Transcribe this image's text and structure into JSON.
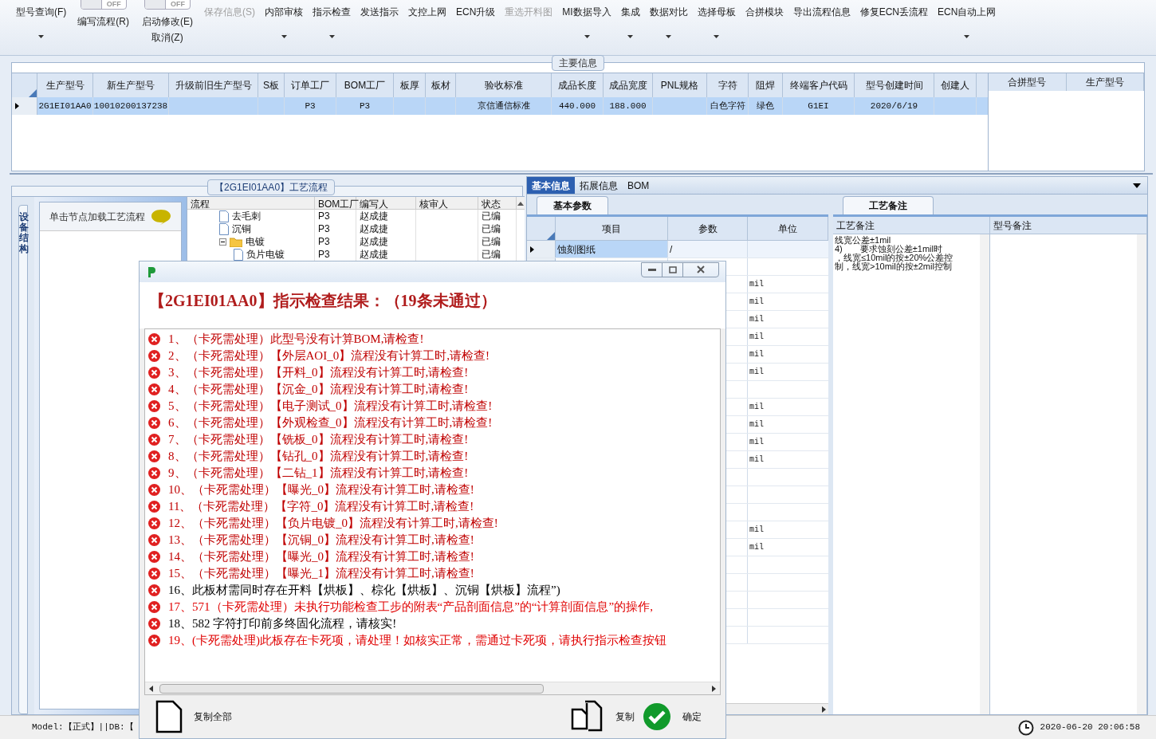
{
  "toolbar": [
    {
      "kind": "button",
      "label": "型号查询(F)",
      "dropdown": true,
      "disabled": false
    },
    {
      "kind": "toggle",
      "label": "编写流程(R)",
      "state": "OFF"
    },
    {
      "kind": "toggle",
      "label": "启动修改(E)",
      "label2": "取消(Z)",
      "state": "OFF"
    },
    {
      "kind": "button",
      "label": "保存信息(S)",
      "dropdown": false,
      "disabled": true
    },
    {
      "kind": "button",
      "label": "内部审核",
      "dropdown": true,
      "disabled": false
    },
    {
      "kind": "button",
      "label": "指示检查",
      "dropdown": true,
      "disabled": false
    },
    {
      "kind": "button",
      "label": "发送指示",
      "dropdown": false,
      "disabled": false
    },
    {
      "kind": "button",
      "label": "文控上网",
      "dropdown": false,
      "disabled": false
    },
    {
      "kind": "button",
      "label": "ECN升级",
      "dropdown": false,
      "disabled": false
    },
    {
      "kind": "button",
      "label": "重选开料图",
      "dropdown": false,
      "disabled": true
    },
    {
      "kind": "button",
      "label": "MI数据导入",
      "dropdown": true,
      "disabled": false
    },
    {
      "kind": "button",
      "label": "集成",
      "dropdown": true,
      "disabled": false
    },
    {
      "kind": "button",
      "label": "数据对比",
      "dropdown": true,
      "disabled": false
    },
    {
      "kind": "button",
      "label": "选择母板",
      "dropdown": true,
      "disabled": false
    },
    {
      "kind": "button",
      "label": "合拼模块",
      "dropdown": false,
      "disabled": false
    },
    {
      "kind": "button",
      "label": "导出流程信息",
      "dropdown": false,
      "disabled": false
    },
    {
      "kind": "button",
      "label": "修复ECN丢流程",
      "dropdown": false,
      "disabled": false
    },
    {
      "kind": "button",
      "label": "ECN自动上网",
      "dropdown": true,
      "disabled": false
    }
  ],
  "main_info": {
    "title": "主要信息",
    "columns": [
      "生产型号",
      "新生产型号",
      "升级前旧生产型号",
      "S板",
      "订单工厂",
      "BOM工厂",
      "板厚",
      "板材",
      "验收标准",
      "成品长度",
      "成品宽度",
      "PNL规格",
      "字符",
      "阻焊",
      "终端客户代码",
      "型号创建时间",
      "创建人"
    ],
    "rows": [
      {
        "selected": true,
        "cells": [
          "2G1EI01AA0",
          "10010200137238",
          "",
          "",
          "P3",
          "P3",
          "",
          "",
          "京信通信标准",
          "440.000",
          "188.000",
          "",
          "白色字符",
          "绿色",
          "G1EI",
          "2020/6/19",
          ""
        ]
      }
    ],
    "side_columns": [
      "合拼型号",
      "生产型号"
    ]
  },
  "process": {
    "title": "【2G1EI01AA0】工艺流程",
    "vertical_tab": "设备结构",
    "hint": "单击节点加载工艺流程",
    "columns": [
      "流程",
      "BOM工厂",
      "编写人",
      "核审人",
      "状态"
    ],
    "tree": [
      {
        "label": "去毛刺",
        "kind": "file",
        "cells": [
          "P3",
          "赵成捷",
          "",
          "已编"
        ]
      },
      {
        "label": "沉铜",
        "kind": "file",
        "cells": [
          "P3",
          "赵成捷",
          "",
          "已编"
        ]
      },
      {
        "label": "电镀",
        "kind": "folder",
        "expanded": true,
        "cells": [
          "P3",
          "赵成捷",
          "",
          "已编"
        ],
        "children": [
          {
            "label": "负片电镀",
            "kind": "file",
            "cells": [
              "P3",
              "赵成捷",
              "",
              "已编"
            ]
          }
        ]
      }
    ]
  },
  "detail": {
    "tabs": [
      {
        "label": "基本信息",
        "selected": true
      },
      {
        "label": "拓展信息",
        "selected": false
      },
      {
        "label": "BOM",
        "selected": false
      }
    ],
    "params": {
      "tab": "基本参数",
      "columns": [
        "项目",
        "参数",
        "单位"
      ],
      "rows": [
        {
          "item": "蚀刻图纸",
          "param": "/",
          "selected": true
        },
        {
          "selected": false
        },
        {
          "unit": "mil",
          "selected": false
        },
        {
          "unit": "mil",
          "selected": false
        },
        {
          "unit": "mil",
          "selected": false
        },
        {
          "unit": "mil",
          "selected": false
        },
        {
          "unit": "mil",
          "selected": false
        },
        {
          "unit": "mil",
          "selected": false
        },
        {
          "selected": false
        },
        {
          "unit": "mil",
          "selected": false
        },
        {
          "unit": "mil",
          "selected": false
        },
        {
          "unit": "mil",
          "selected": false
        },
        {
          "unit": "mil",
          "selected": false
        },
        {
          "selected": false
        },
        {
          "selected": false
        },
        {
          "selected": false
        },
        {
          "unit": "mil",
          "selected": false
        },
        {
          "unit": "mil",
          "selected": false
        },
        {
          "selected": false
        },
        {
          "selected": false
        },
        {
          "selected": false
        },
        {
          "selected": false
        },
        {
          "selected": false
        }
      ]
    },
    "remarks": {
      "tab": "工艺备注",
      "columns": [
        "工艺备注",
        "型号备注"
      ],
      "lines": [
        "线宽公差±1mil",
        "4)　　要求蚀刻公差±1mil时",
        "，线宽≤10mil的按±20%公差控",
        "制，线宽>10mil的按±2mil控制"
      ]
    }
  },
  "dialog": {
    "heading": "【2G1EI01AA0】指示检查结果：（19条未通过）",
    "items": [
      {
        "text": "1、（卡死需处理）此型号没有计算BOM,请检查!",
        "color": "#c00000"
      },
      {
        "text": "2、（卡死需处理）【外层AOI_0】流程没有计算工时,请检查!",
        "color": "#c00000"
      },
      {
        "text": "3、（卡死需处理）【开料_0】流程没有计算工时,请检查!",
        "color": "#c00000"
      },
      {
        "text": "4、（卡死需处理）【沉金_0】流程没有计算工时,请检查!",
        "color": "#c00000"
      },
      {
        "text": "5、（卡死需处理）【电子测试_0】流程没有计算工时,请检查!",
        "color": "#c00000"
      },
      {
        "text": "6、（卡死需处理）【外观检查_0】流程没有计算工时,请检查!",
        "color": "#c00000"
      },
      {
        "text": "7、（卡死需处理）【铣板_0】流程没有计算工时,请检查!",
        "color": "#c00000"
      },
      {
        "text": "8、（卡死需处理）【钻孔_0】流程没有计算工时,请检查!",
        "color": "#c00000"
      },
      {
        "text": "9、（卡死需处理）【二钻_1】流程没有计算工时,请检查!",
        "color": "#c00000"
      },
      {
        "text": "10、（卡死需处理）【曝光_0】流程没有计算工时,请检查!",
        "color": "#c00000"
      },
      {
        "text": "11、（卡死需处理）【字符_0】流程没有计算工时,请检查!",
        "color": "#c00000"
      },
      {
        "text": "12、（卡死需处理）【负片电镀_0】流程没有计算工时,请检查!",
        "color": "#c00000"
      },
      {
        "text": "13、（卡死需处理）【沉铜_0】流程没有计算工时,请检查!",
        "color": "#c00000"
      },
      {
        "text": "14、（卡死需处理）【曝光_0】流程没有计算工时,请检查!",
        "color": "#c00000"
      },
      {
        "text": "15、（卡死需处理）【曝光_1】流程没有计算工时,请检查!",
        "color": "#c00000"
      },
      {
        "text": "16、此板材需同时存在开料【烘板】、棕化【烘板】、沉铜【烘板】流程”)",
        "color": "#000000"
      },
      {
        "text": "17、571（卡死需处理）未执行功能检查工步的附表“产品剖面信息”的“计算剖面信息”的操作,",
        "color": "#e00000"
      },
      {
        "text": "18、582 字符打印前多终固化流程，请核实!",
        "color": "#000000"
      },
      {
        "text": "19、(卡死需处理)此板存在卡死项，请处理！如核实正常，需通过卡死项，请执行指示检查按钮",
        "color": "#e00000"
      }
    ],
    "buttons": [
      {
        "kind": "copy_all",
        "label": "复制全部"
      },
      {
        "kind": "copy",
        "label": "复制"
      },
      {
        "kind": "ok",
        "label": "确定"
      }
    ]
  },
  "status_bar": {
    "model": "Model:【正式】||DB:【",
    "time": "2020-06-20 20:06:58"
  }
}
